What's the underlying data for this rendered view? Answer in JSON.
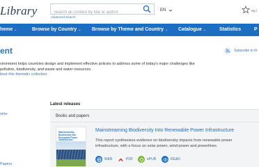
{
  "header": {
    "logo": "Library",
    "search_placeholder": "Search all content by title or author",
    "advanced_search": "Advanced Search",
    "language": "EN",
    "my_label": "My l"
  },
  "nav": {
    "items": [
      {
        "label": "heme",
        "chevron": true
      },
      {
        "label": "Browse by Country",
        "chevron": true
      },
      {
        "label": "Browse by Theme and Country",
        "chevron": true
      },
      {
        "label": "Catalogue",
        "chevron": true
      },
      {
        "label": "Statistics",
        "chevron": false
      },
      {
        "label": "P",
        "chevron": false
      }
    ]
  },
  "page": {
    "title": "ent",
    "subscribe": "Subscribe to th",
    "description": "vironment helps countries design and implement effective policies to address some of today's major challenges like pollution, biodiversity, and waste and water resources.",
    "about_link": "bout this thematic collection"
  },
  "sidebar": {
    "link_home": "ome",
    "link_papers": "Papers"
  },
  "latest": {
    "section_title": "Latest releases",
    "category": "Books and papers",
    "item": {
      "cover_title": "Mainstreaming Biodiversity into Renewable Power Infrastructure",
      "title": "Mainstreaming Biodiversity Into Renewable Power Infrastructure",
      "description": "This report synthesises evidence on biodiversity impacts from renewable power infrastructure, with a focus on solar power, wind power and powerlines.",
      "formats": [
        {
          "label": "WEB",
          "icon": "web-icon",
          "color": "#1d6ec0"
        },
        {
          "label": "PDF",
          "icon": "pdf-icon",
          "color": "#e0362c"
        },
        {
          "label": "ePUB",
          "icon": "epub-icon",
          "color": "#7bb32e"
        },
        {
          "label": "READ",
          "icon": "read-icon",
          "color": "#1d6ec0"
        }
      ]
    }
  },
  "colors": {
    "nav_bg": "#1d6ec0",
    "link": "#3b72b5",
    "title": "#2b78c2"
  }
}
